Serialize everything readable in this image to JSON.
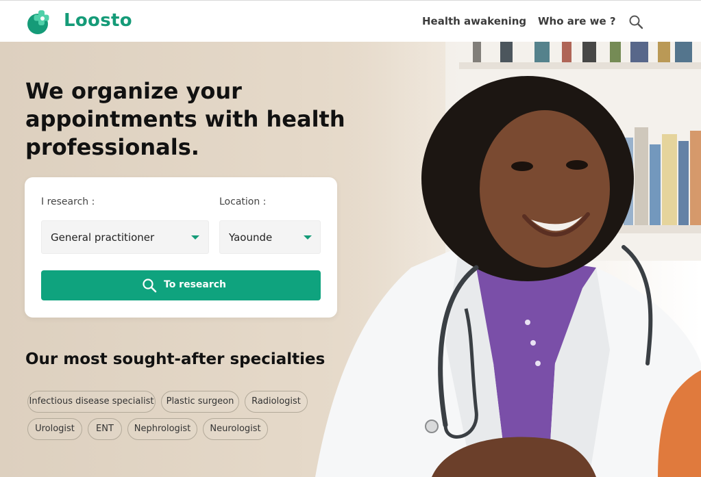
{
  "header": {
    "brand": "Loosto",
    "nav": [
      "Health awakening",
      "Who are we ?"
    ],
    "search_icon": "search-icon"
  },
  "hero": {
    "headline": "We organize your appointments with health professionals.",
    "image": "doctor-smiling-with-stethoscope"
  },
  "search": {
    "research_label": "I research :",
    "location_label": "Location :",
    "specialty_value": "General practitioner",
    "location_value": "Yaounde",
    "button_label": "To research",
    "button_icon": "search-icon"
  },
  "specialties": {
    "title": "Our most sought-after specialties",
    "chips": [
      "Infectious disease specialist",
      "Plastic surgeon",
      "Radiologist",
      "Urologist",
      "ENT",
      "Nephrologist",
      "Neurologist"
    ]
  },
  "colors": {
    "brand": "#159b78",
    "button": "#0fa37e",
    "hero_bg": "#e2d6c6",
    "text": "#111111"
  }
}
